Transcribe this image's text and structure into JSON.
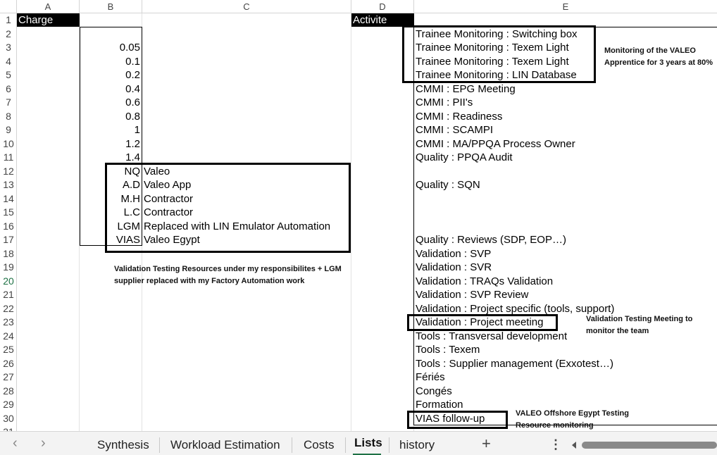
{
  "columns": [
    "A",
    "B",
    "C",
    "D",
    "E"
  ],
  "rows": [
    "1",
    "2",
    "3",
    "4",
    "5",
    "6",
    "7",
    "8",
    "9",
    "10",
    "11",
    "12",
    "13",
    "14",
    "15",
    "16",
    "17",
    "18",
    "19",
    "20",
    "21",
    "22",
    "23",
    "24",
    "25",
    "26",
    "27",
    "28",
    "29",
    "30",
    "31"
  ],
  "headers": {
    "charge": "Charge",
    "activite": "Activite"
  },
  "charge_values": [
    "0.05",
    "0.1",
    "0.2",
    "0.4",
    "0.6",
    "0.8",
    "1",
    "1.2",
    "1.4"
  ],
  "resources": [
    {
      "code": "NQ",
      "company": "Valeo"
    },
    {
      "code": "A.D",
      "company": "Valeo App"
    },
    {
      "code": "M.H",
      "company": "Contractor"
    },
    {
      "code": "L.C",
      "company": "Contractor"
    },
    {
      "code": "LGM",
      "company": "Replaced with LIN Emulator Automation"
    },
    {
      "code": "VIAS",
      "company": "Valeo Egypt"
    }
  ],
  "activities": {
    "r2": "Trainee Monitoring : Switching box",
    "r3": "Trainee Monitoring : Texem Light",
    "r4": "Trainee Monitoring : Texem Light",
    "r5": "Trainee Monitoring : LIN Database",
    "r6": "CMMI : EPG Meeting",
    "r7": "CMMI : PII's",
    "r8": "CMMI : Readiness",
    "r9": "CMMI : SCAMPI",
    "r10": "CMMI : MA/PPQA Process Owner",
    "r11": "Quality : PPQA Audit",
    "r13": "Quality : SQN",
    "r17": "Quality : Reviews (SDP, EOP…)",
    "r18": "Validation : SVP",
    "r19": "Validation : SVR",
    "r20": "Validation : TRAQs Validation",
    "r21": "Validation : SVP Review",
    "r22": "Validation : Project specific (tools, support)",
    "r23": "Validation : Project meeting",
    "r24": "Tools : Transversal development",
    "r25": "Tools : Texem",
    "r26": "Tools : Supplier management (Exxotest…)",
    "r27": "Fériés",
    "r28": "Congés",
    "r29": "Formation",
    "r30": "VIAS follow-up"
  },
  "notes": {
    "valeo_apprentice": [
      "Monitoring of the VALEO",
      "Apprentice for 3 years at 80%"
    ],
    "validation_resources": [
      "Validation Testing Resources under my responsibilites + LGM",
      "supplier replaced with my Factory Automation work"
    ],
    "validation_meeting": [
      "Validation Testing Meeting to",
      "monitor the team"
    ],
    "offshore_egypt": [
      "VALEO Offshore Egypt Testing",
      "Resource monitoring"
    ]
  },
  "tabs": [
    {
      "label": "Synthesis",
      "active": false
    },
    {
      "label": "Workload Estimation",
      "active": false
    },
    {
      "label": "Costs",
      "active": false
    },
    {
      "label": "Lists",
      "active": true
    },
    {
      "label": "history",
      "active": false
    }
  ],
  "colors": {
    "accent": "#1e7145",
    "header_bg": "#000000"
  },
  "icons": [
    "chevron-left-icon",
    "chevron-right-icon",
    "add-sheet-icon",
    "more-options-icon",
    "scroll-left-icon"
  ]
}
